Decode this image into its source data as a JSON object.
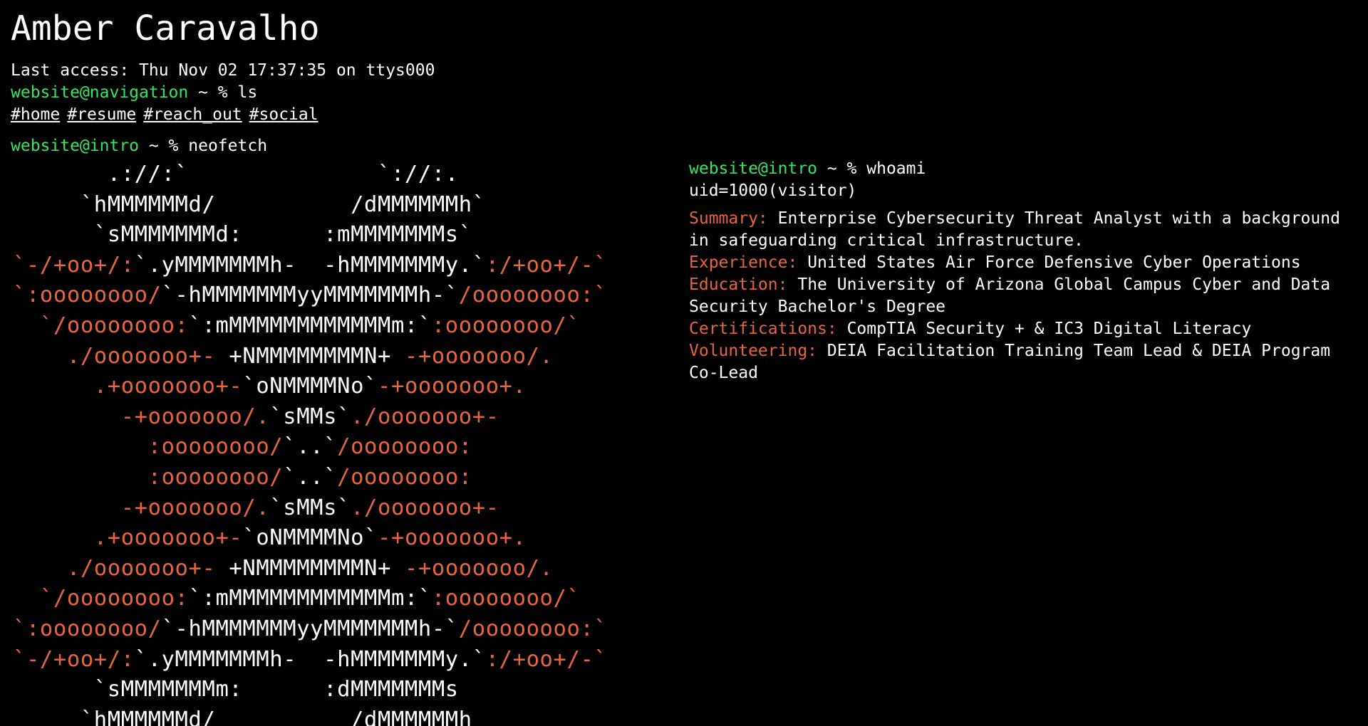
{
  "header": {
    "name": "Amber Caravalho",
    "last_access": "Last access: Thu Nov 02 17:37:35 on ttys000"
  },
  "colors": {
    "background": "#000000",
    "prompt_user": "#2ee862",
    "accent_orange": "#e8653f",
    "text": "#ffffff"
  },
  "navigation": {
    "prompt_user": "website@navigation",
    "prompt_rest": " ~ % ",
    "command": "ls",
    "links": [
      "#home",
      "#resume",
      "#reach_out",
      "#social"
    ]
  },
  "intro": {
    "prompt_user": "website@intro",
    "prompt_rest": " ~ % ",
    "command": "neofetch"
  },
  "ascii_art": [
    [
      [
        "w",
        "       .://:`              `://:."
      ]
    ],
    [
      [
        "w",
        "     `hMMMMMMd/          /dMMMMMMh`"
      ]
    ],
    [
      [
        "w",
        "      `sMMMMMMMd:      :mMMMMMMMs`"
      ]
    ],
    [
      [
        "o",
        "`-/+oo+/:"
      ],
      [
        "w",
        "`.yMMMMMMMh-  -hMMMMMMMy.`"
      ],
      [
        "o",
        ":/+oo+/-`"
      ]
    ],
    [
      [
        "o",
        "`:oooooooo/"
      ],
      [
        "w",
        "`-hMMMMMMMyyMMMMMMMh-`"
      ],
      [
        "o",
        "/oooooooo:`"
      ]
    ],
    [
      [
        "o",
        "  `/oooooooo:"
      ],
      [
        "w",
        "`:mMMMMMMMMMMMMm:`"
      ],
      [
        "o",
        ":oooooooo/`"
      ]
    ],
    [
      [
        "o",
        "    ./ooooooo+- "
      ],
      [
        "w",
        "+NMMMMMMMMN+"
      ],
      [
        "o",
        " -+ooooooo/."
      ]
    ],
    [
      [
        "o",
        "      .+ooooooo+-"
      ],
      [
        "w",
        "`oNMMMMNo`"
      ],
      [
        "o",
        "-+ooooooo+."
      ]
    ],
    [
      [
        "o",
        "        -+ooooooo/."
      ],
      [
        "w",
        "`sMMs`"
      ],
      [
        "o",
        "./ooooooo+-"
      ]
    ],
    [
      [
        "o",
        "          :oooooooo/"
      ],
      [
        "w",
        "`..`"
      ],
      [
        "o",
        "/oooooooo:"
      ]
    ],
    [
      [
        "o",
        "          :oooooooo/"
      ],
      [
        "w",
        "`..`"
      ],
      [
        "o",
        "/oooooooo:"
      ]
    ],
    [
      [
        "o",
        "        -+ooooooo/."
      ],
      [
        "w",
        "`sMMs`"
      ],
      [
        "o",
        "./ooooooo+-"
      ]
    ],
    [
      [
        "o",
        "      .+ooooooo+-"
      ],
      [
        "w",
        "`oNMMMMNo`"
      ],
      [
        "o",
        "-+ooooooo+."
      ]
    ],
    [
      [
        "o",
        "    ./ooooooo+- "
      ],
      [
        "w",
        "+NMMMMMMMMN+"
      ],
      [
        "o",
        " -+ooooooo/."
      ]
    ],
    [
      [
        "o",
        "  `/oooooooo:"
      ],
      [
        "w",
        "`:mMMMMMMMMMMMMm:`"
      ],
      [
        "o",
        ":oooooooo/`"
      ]
    ],
    [
      [
        "o",
        "`:oooooooo/"
      ],
      [
        "w",
        "`-hMMMMMMMyyMMMMMMMh-`"
      ],
      [
        "o",
        "/oooooooo:`"
      ]
    ],
    [
      [
        "o",
        "`-/+oo+/:"
      ],
      [
        "w",
        "`.yMMMMMMMh-  -hMMMMMMMy.`"
      ],
      [
        "o",
        ":/+oo+/-`"
      ]
    ],
    [
      [
        "w",
        "      `sMMMMMMMm:      :dMMMMMMMs"
      ]
    ],
    [
      [
        "w",
        "     `hMMMMMMd/          /dMMMMMMh"
      ]
    ]
  ],
  "whoami": {
    "prompt_user": "website@intro",
    "prompt_rest": " ~ % ",
    "command": "whoami",
    "uid": "uid=1000(visitor)",
    "entries": [
      {
        "label": "Summary:",
        "value": "Enterprise Cybersecurity Threat Analyst with a background in safeguarding critical infrastructure."
      },
      {
        "label": "Experience:",
        "value": "United States Air Force Defensive Cyber Operations"
      },
      {
        "label": "Education:",
        "value": "The University of Arizona Global Campus Cyber and Data Security Bachelor's Degree"
      },
      {
        "label": "Certifications:",
        "value": "CompTIA Security + & IC3 Digital Literacy"
      },
      {
        "label": "Volunteering:",
        "value": "DEIA Facilitation Training Team Lead & DEIA Program Co-Lead"
      }
    ]
  }
}
